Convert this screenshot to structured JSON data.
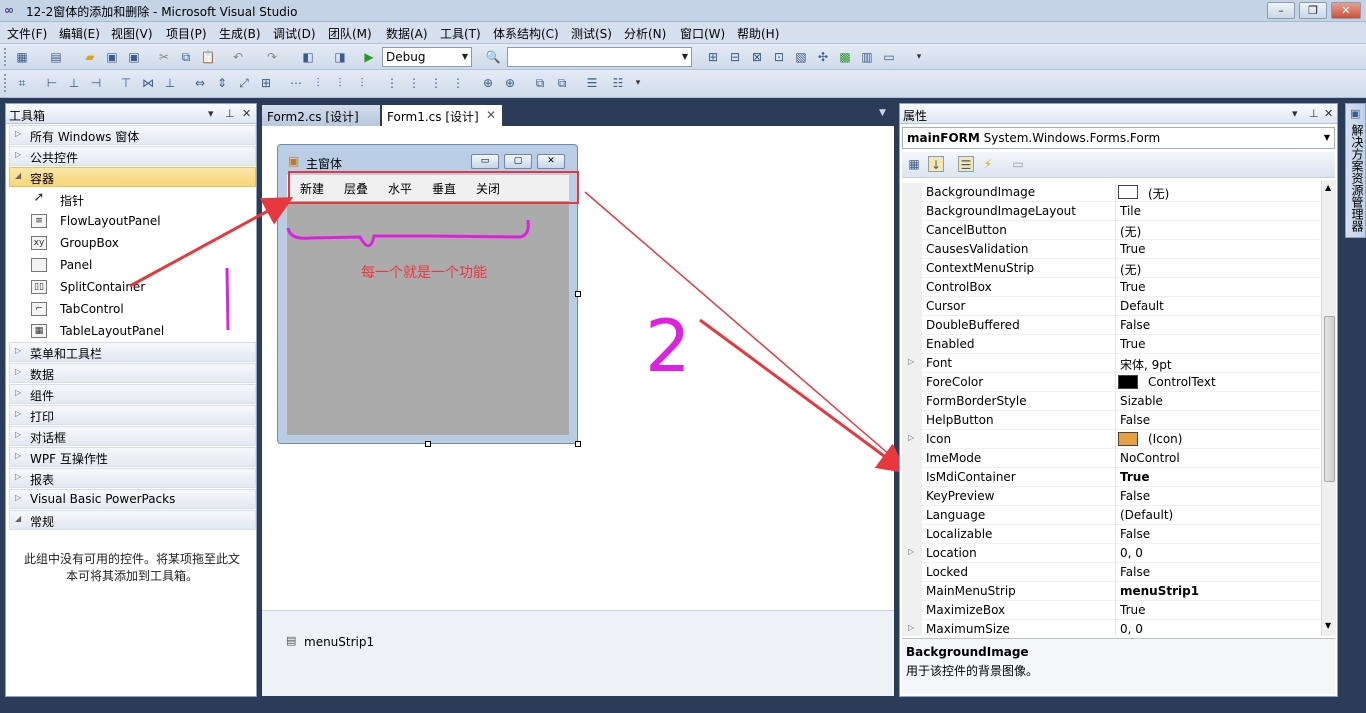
{
  "window": {
    "title": "12-2窗体的添加和删除 - Microsoft Visual Studio"
  },
  "menubar": [
    "文件(F)",
    "编辑(E)",
    "视图(V)",
    "项目(P)",
    "生成(B)",
    "调试(D)",
    "团队(M)",
    "数据(A)",
    "工具(T)",
    "体系结构(C)",
    "测试(S)",
    "分析(N)",
    "窗口(W)",
    "帮助(H)"
  ],
  "toolbar": {
    "config": "Debug",
    "platform": ""
  },
  "toolbox": {
    "title": "工具箱",
    "groups_top": [
      "所有 Windows 窗体",
      "公共控件"
    ],
    "container_group": "容器",
    "items": [
      {
        "label": "指针",
        "icon": "pointer-icon"
      },
      {
        "label": "FlowLayoutPanel",
        "icon": "flowlayoutpanel-icon"
      },
      {
        "label": "GroupBox",
        "icon": "groupbox-icon"
      },
      {
        "label": "Panel",
        "icon": "panel-icon"
      },
      {
        "label": "SplitContainer",
        "icon": "splitcontainer-icon"
      },
      {
        "label": "TabControl",
        "icon": "tabcontrol-icon"
      },
      {
        "label": "TableLayoutPanel",
        "icon": "tablelayoutpanel-icon"
      }
    ],
    "groups_bottom": [
      "菜单和工具栏",
      "数据",
      "组件",
      "打印",
      "对话框",
      "WPF 互操作性",
      "报表",
      "Visual Basic PowerPacks"
    ],
    "general_group": "常规",
    "empty_message": "此组中没有可用的控件。将某项拖至此文本可将其添加到工具箱。"
  },
  "tabs": [
    {
      "label": "Form2.cs [设计]",
      "active": false
    },
    {
      "label": "Form1.cs [设计]",
      "active": true
    }
  ],
  "form": {
    "title": "主窗体",
    "menu": [
      "新建",
      "层叠",
      "水平",
      "垂直",
      "关闭"
    ]
  },
  "annotations": {
    "note": "每一个就是一个功能",
    "number": "2"
  },
  "tray": {
    "component": "menuStrip1"
  },
  "properties": {
    "title": "属性",
    "object_name": "mainFORM",
    "object_type": "System.Windows.Forms.Form",
    "rows": [
      {
        "name": "BackgroundImage",
        "value": "(无)",
        "swatch": "#ffffff"
      },
      {
        "name": "BackgroundImageLayout",
        "value": "Tile"
      },
      {
        "name": "CancelButton",
        "value": "(无)"
      },
      {
        "name": "CausesValidation",
        "value": "True"
      },
      {
        "name": "ContextMenuStrip",
        "value": "(无)"
      },
      {
        "name": "ControlBox",
        "value": "True"
      },
      {
        "name": "Cursor",
        "value": "Default"
      },
      {
        "name": "DoubleBuffered",
        "value": "False"
      },
      {
        "name": "Enabled",
        "value": "True"
      },
      {
        "name": "Font",
        "value": "宋体, 9pt",
        "expandable": true
      },
      {
        "name": "ForeColor",
        "value": "ControlText",
        "swatch": "#000000"
      },
      {
        "name": "FormBorderStyle",
        "value": "Sizable"
      },
      {
        "name": "HelpButton",
        "value": "False"
      },
      {
        "name": "Icon",
        "value": "(Icon)",
        "expandable": true,
        "swatch": "#e8a040"
      },
      {
        "name": "ImeMode",
        "value": "NoControl"
      },
      {
        "name": "IsMdiContainer",
        "value": "True",
        "bold": true
      },
      {
        "name": "KeyPreview",
        "value": "False"
      },
      {
        "name": "Language",
        "value": "(Default)"
      },
      {
        "name": "Localizable",
        "value": "False"
      },
      {
        "name": "Location",
        "value": "0, 0",
        "expandable": true
      },
      {
        "name": "Locked",
        "value": "False"
      },
      {
        "name": "MainMenuStrip",
        "value": "menuStrip1",
        "bold": true
      },
      {
        "name": "MaximizeBox",
        "value": "True"
      },
      {
        "name": "MaximumSize",
        "value": "0, 0",
        "expandable": true
      }
    ],
    "desc_title": "BackgroundImage",
    "desc_text": "用于该控件的背景图像。"
  },
  "side_tab": "解决方案资源管理器",
  "colors": {
    "annotation_red": "#e8383d",
    "annotation_magenta": "#e020e0"
  }
}
